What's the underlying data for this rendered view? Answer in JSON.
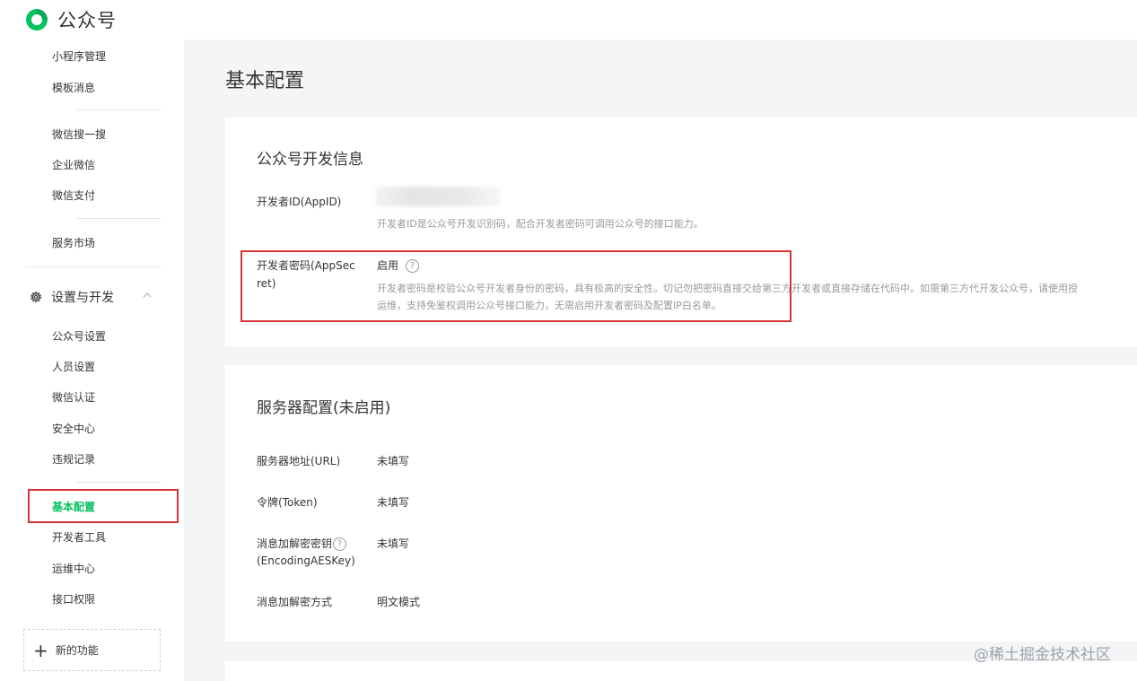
{
  "app": {
    "title": "公众号"
  },
  "sidebar": {
    "items_top": [
      {
        "label": "小程序管理"
      },
      {
        "label": "模板消息"
      },
      {
        "label": "微信搜一搜"
      },
      {
        "label": "企业微信"
      },
      {
        "label": "微信支付"
      },
      {
        "label": "服务市场"
      }
    ],
    "group": {
      "label": "设置与开发",
      "expanded": true
    },
    "items_group": [
      {
        "label": "公众号设置"
      },
      {
        "label": "人员设置"
      },
      {
        "label": "微信认证"
      },
      {
        "label": "安全中心"
      },
      {
        "label": "违规记录"
      },
      {
        "label": "基本配置",
        "active": true
      },
      {
        "label": "开发者工具"
      },
      {
        "label": "运维中心"
      },
      {
        "label": "接口权限"
      }
    ],
    "new_feature": "新的功能"
  },
  "main": {
    "title": "基本配置",
    "dev_info": {
      "title": "公众号开发信息",
      "appid_label": "开发者ID(AppID)",
      "appid_desc": "开发者ID是公众号开发识别码，配合开发者密码可调用公众号的接口能力。",
      "secret_label_line1": "开发者密码(AppSec",
      "secret_label_line2": "ret)",
      "secret_value": "启用",
      "secret_help_icon": "?",
      "secret_desc_line1": "开发者密码是校验公众号开发者身份的密码，具有极高的安全性。切记勿把密码直接交给第三方开发者或直接存储在代码中。如需第三方代开发公众号，请使用授",
      "secret_desc_line2": "运维，支持免鉴权调用公众号接口能力，无需启用开发者密码及配置IP白名单。"
    },
    "server": {
      "title": "服务器配置(未启用)",
      "url_label": "服务器地址(URL)",
      "url_value": "未填写",
      "token_label": "令牌(Token)",
      "token_value": "未填写",
      "aes_label_line1": "消息加解密密钥",
      "aes_help_icon": "?",
      "aes_label_line2": "(EncodingAESKey)",
      "aes_value": "未填写",
      "mode_label": "消息加解密方式",
      "mode_value": "明文模式"
    }
  },
  "watermark": "@稀土掘金技术社区",
  "colors": {
    "accent": "#07c160",
    "highlight": "#d9343a",
    "background": "#f4f5f7"
  }
}
